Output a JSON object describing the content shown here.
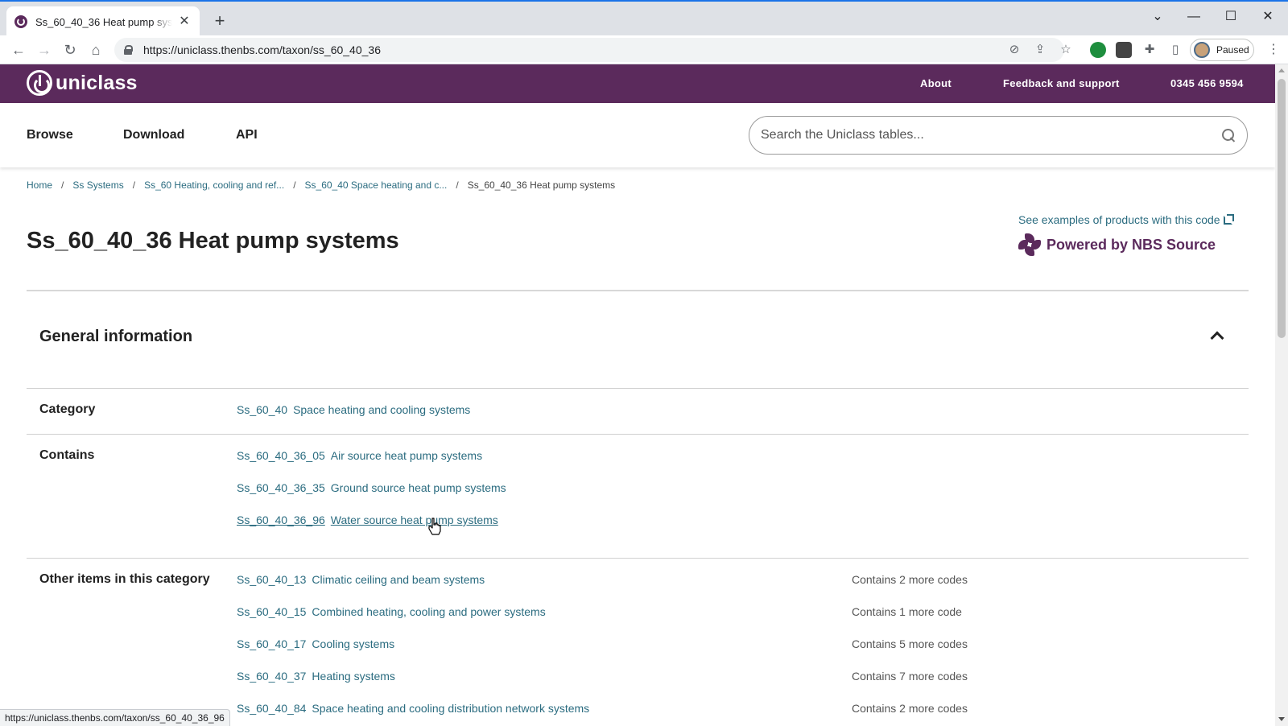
{
  "browser": {
    "tab_title": "Ss_60_40_36  Heat pump systems",
    "url_host": "https://uniclass.thenbs.com",
    "url_path": "/taxon/ss_60_40_36",
    "profile_label": "Paused",
    "status_url": "https://uniclass.thenbs.com/taxon/ss_60_40_36_96"
  },
  "header": {
    "logo_text": "uniclass",
    "links": [
      "About",
      "Feedback and support",
      "0345 456 9594"
    ]
  },
  "nav": {
    "items": [
      "Browse",
      "Download",
      "API"
    ],
    "search_placeholder": "Search the Uniclass tables..."
  },
  "breadcrumb": [
    "Home",
    "Ss  Systems",
    "Ss_60  Heating, cooling and ref...",
    "Ss_60_40  Space heating and c...",
    "Ss_60_40_36  Heat pump systems"
  ],
  "page": {
    "title": "Ss_60_40_36  Heat pump systems",
    "examples_link": "See examples of products with this code",
    "powered_by": "Powered by NBS Source"
  },
  "general": {
    "title": "General information",
    "category_label": "Category",
    "category": {
      "code": "Ss_60_40",
      "name": "Space heating and cooling systems"
    },
    "contains_label": "Contains",
    "contains": [
      {
        "code": "Ss_60_40_36_05",
        "name": "Air source heat pump systems"
      },
      {
        "code": "Ss_60_40_36_35",
        "name": "Ground source heat pump systems"
      },
      {
        "code": "Ss_60_40_36_96",
        "name": "Water source heat pump systems"
      }
    ],
    "other_label": "Other items in this category",
    "other": [
      {
        "code": "Ss_60_40_13",
        "name": "Climatic ceiling and beam systems",
        "count": "Contains 2 more codes"
      },
      {
        "code": "Ss_60_40_15",
        "name": "Combined heating, cooling and power systems",
        "count": "Contains 1 more code"
      },
      {
        "code": "Ss_60_40_17",
        "name": "Cooling systems",
        "count": "Contains 5 more codes"
      },
      {
        "code": "Ss_60_40_37",
        "name": "Heating systems",
        "count": "Contains 7 more codes"
      },
      {
        "code": "Ss_60_40_84",
        "name": "Space heating and cooling distribution network systems",
        "count": "Contains 2 more codes"
      }
    ]
  },
  "colors": {
    "brand": "#5b2a5c",
    "link": "#2b6c80"
  }
}
